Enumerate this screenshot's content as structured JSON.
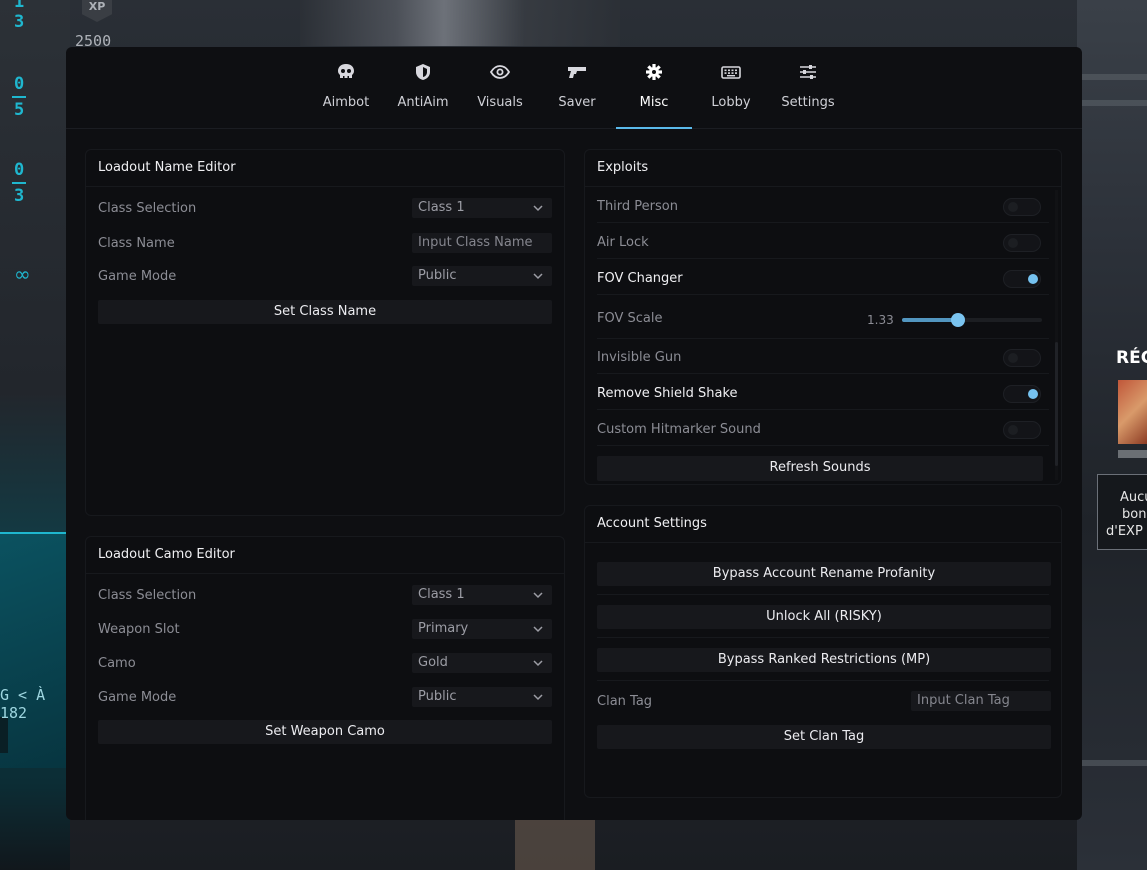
{
  "background": {
    "hud_numbers": [
      "1",
      "3",
      "0",
      "5",
      "0",
      "3"
    ],
    "hud_infinity": "∞",
    "hud_text": "G < À 182",
    "xp_badge": "XP",
    "xp_value": "2500",
    "rec_title": "RÉC",
    "rec_card_lines": [
      "Aucu",
      "bonu",
      "d'EXP a"
    ]
  },
  "tabs": [
    {
      "label": "Aimbot",
      "icon": "skull-icon"
    },
    {
      "label": "AntiAim",
      "icon": "shield-icon"
    },
    {
      "label": "Visuals",
      "icon": "eye-icon"
    },
    {
      "label": "Saver",
      "icon": "gun-icon"
    },
    {
      "label": "Misc",
      "icon": "gear-icon",
      "active": true
    },
    {
      "label": "Lobby",
      "icon": "keyboard-icon"
    },
    {
      "label": "Settings",
      "icon": "sliders-icon"
    }
  ],
  "loadout_name": {
    "title": "Loadout Name Editor",
    "class_selection_label": "Class Selection",
    "class_selection_value": "Class 1",
    "class_name_label": "Class Name",
    "class_name_placeholder": "Input Class Name",
    "game_mode_label": "Game Mode",
    "game_mode_value": "Public",
    "set_button": "Set Class Name"
  },
  "loadout_camo": {
    "title": "Loadout Camo Editor",
    "class_selection_label": "Class Selection",
    "class_selection_value": "Class 1",
    "weapon_slot_label": "Weapon Slot",
    "weapon_slot_value": "Primary",
    "camo_label": "Camo",
    "camo_value": "Gold",
    "game_mode_label": "Game Mode",
    "game_mode_value": "Public",
    "set_button": "Set Weapon Camo"
  },
  "exploits": {
    "title": "Exploits",
    "items": [
      {
        "label": "Third Person",
        "on": false
      },
      {
        "label": "Air Lock",
        "on": false
      },
      {
        "label": "FOV Changer",
        "on": true
      }
    ],
    "fov_scale_label": "FOV Scale",
    "fov_scale_value": "1.33",
    "fov_scale_fraction": 0.4,
    "items2": [
      {
        "label": "Invisible Gun",
        "on": false
      },
      {
        "label": "Remove Shield Shake",
        "on": true
      },
      {
        "label": "Custom Hitmarker Sound",
        "on": false
      }
    ],
    "refresh_button": "Refresh Sounds"
  },
  "account": {
    "title": "Account Settings",
    "bypass_rename": "Bypass Account Rename Profanity",
    "unlock_all": "Unlock All (RISKY)",
    "bypass_ranked": "Bypass Ranked Restrictions (MP)",
    "clan_tag_label": "Clan Tag",
    "clan_tag_placeholder": "Input Clan Tag",
    "set_clan_tag": "Set Clan Tag"
  },
  "colors": {
    "accent": "#5ab9ea",
    "panel": "#0e0f12",
    "hud_cyan": "#1fb7cf"
  }
}
